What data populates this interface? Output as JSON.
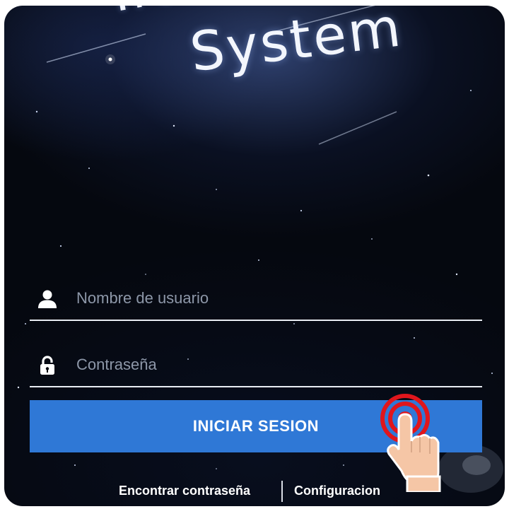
{
  "title": {
    "line1": "Tracking",
    "line2": "System"
  },
  "form": {
    "username_placeholder": "Nombre de usuario",
    "username_icon": "user-icon",
    "password_placeholder": "Contraseña",
    "password_icon": "padlock-icon",
    "login_button": "INICIAR SESION",
    "button_color": "#2f78d6"
  },
  "links": {
    "find_password": "Encontrar contraseña",
    "settings": "Configuracion"
  },
  "overlay": {
    "tap_indicator": "tap-hand-icon",
    "tap_color": "#e0161c"
  }
}
